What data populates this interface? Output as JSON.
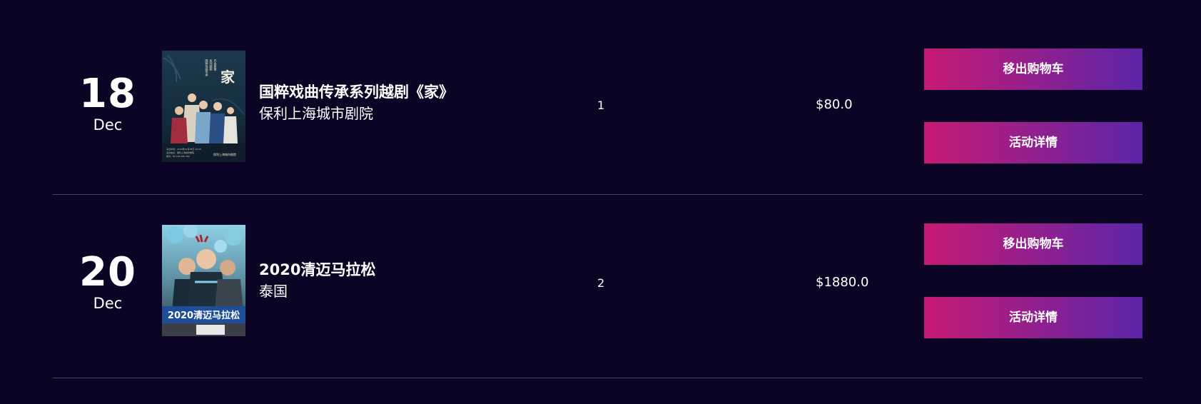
{
  "cart": {
    "items": [
      {
        "day": "18",
        "month": "Dec",
        "title": "国粹戏曲传承系列越剧《家》",
        "venue": "保利上海城市剧院",
        "quantity": "1",
        "price": "$80.0",
        "remove_label": "移出购物车",
        "detail_label": "活动详情",
        "poster": {
          "vertical_text": "国粹戏曲传承系列越剧",
          "main_char": "家",
          "footer": "保利上海城市剧院"
        }
      },
      {
        "day": "20",
        "month": "Dec",
        "title": "2020清迈马拉松",
        "venue": "泰国",
        "quantity": "2",
        "price": "$1880.0",
        "remove_label": "移出购物车",
        "detail_label": "活动详情",
        "poster": {
          "banner": "2020清迈马拉松"
        }
      }
    ]
  },
  "colors": {
    "background": "#0b0425",
    "button_start": "#c81a74",
    "button_end": "#5b25a8",
    "divider": "#4a4468"
  }
}
